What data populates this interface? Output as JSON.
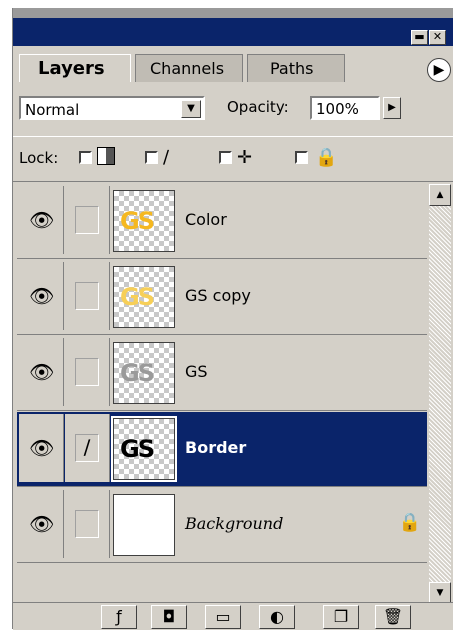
{
  "window": {
    "minimize_glyph": "▬",
    "close_glyph": "✕"
  },
  "tabs": [
    {
      "label": "Layers",
      "active": true
    },
    {
      "label": "Channels",
      "active": false
    },
    {
      "label": "Paths",
      "active": false
    }
  ],
  "panel_menu_glyph": "▶",
  "blend_mode": {
    "value": "Normal",
    "arrow": "▼"
  },
  "opacity": {
    "label": "Opacity:",
    "value": "100%",
    "arrow": "▶"
  },
  "lock": {
    "label": "Lock:",
    "icons": [
      "transparency-lock-icon",
      "brush-lock-icon",
      "move-lock-icon",
      "padlock-icon"
    ]
  },
  "layers": [
    {
      "name": "Color",
      "thumb_text": "GS",
      "thumb_color": "#f5b820",
      "visible": true,
      "selected": false
    },
    {
      "name": "GS copy",
      "thumb_text": "GS",
      "thumb_color": "#f7cf57",
      "visible": true,
      "selected": false
    },
    {
      "name": "GS",
      "thumb_text": "GS",
      "thumb_color": "#9a9a9a",
      "visible": true,
      "selected": false
    },
    {
      "name": "Border",
      "thumb_text": "GS",
      "thumb_color": "#000000",
      "visible": true,
      "selected": true
    },
    {
      "name": "Background",
      "thumb_text": "",
      "thumb_color": "#ffffff",
      "visible": true,
      "selected": false,
      "locked": true
    }
  ],
  "colors": {
    "selected": "#0a246a",
    "panel": "#d4d0c8"
  }
}
